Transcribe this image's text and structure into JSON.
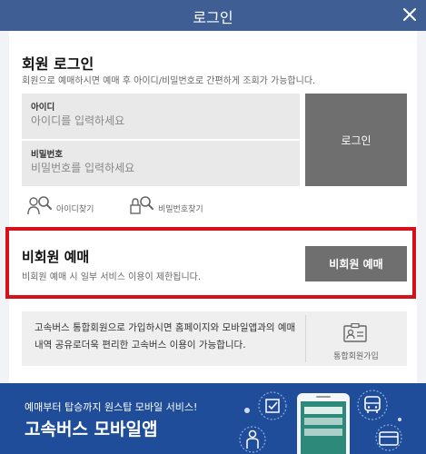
{
  "window": {
    "title": "로그인"
  },
  "member_login": {
    "title": "회원 로그인",
    "description": "회원으로 예매하시면 예매 후 아이디/비밀번호로 간편하게 조회가 가능합니다.",
    "id_field": {
      "label": "아이디",
      "placeholder": "아이디를 입력하세요",
      "value": ""
    },
    "pw_field": {
      "label": "비밀번호",
      "placeholder": "비밀번호를 입력하세요",
      "value": ""
    },
    "login_button": "로그인",
    "find_id": "아이디찾기",
    "find_pw": "비밀번호찾기"
  },
  "guest": {
    "title": "비회원 예매",
    "description": "비회원 예매 시 일부 서비스 이용이 제한됩니다.",
    "button": "비회원 예매"
  },
  "membership": {
    "description": "고속버스 통합회원으로 가입하시면 홈페이지와 모바일앱과의 예매내역 공유로더욱 편리한 고속버스 이용이 가능합니다.",
    "join_label": "통합회원가입"
  },
  "banner": {
    "subtitle": "예매부터 탑승까지 원스탑 모바일 서비스!",
    "title": "고속버스 모바일앱"
  },
  "colors": {
    "titlebar": "#3f5f94",
    "highlight_border": "#d7111a",
    "button_gray": "#6f6f6f",
    "banner_blue": "#1f4d9a"
  },
  "icons": [
    "close-icon",
    "find-id-icon",
    "find-pw-icon",
    "id-card-icon",
    "phone-icon",
    "checkbox-icon",
    "bus-icon",
    "card-icon",
    "person-icon"
  ]
}
